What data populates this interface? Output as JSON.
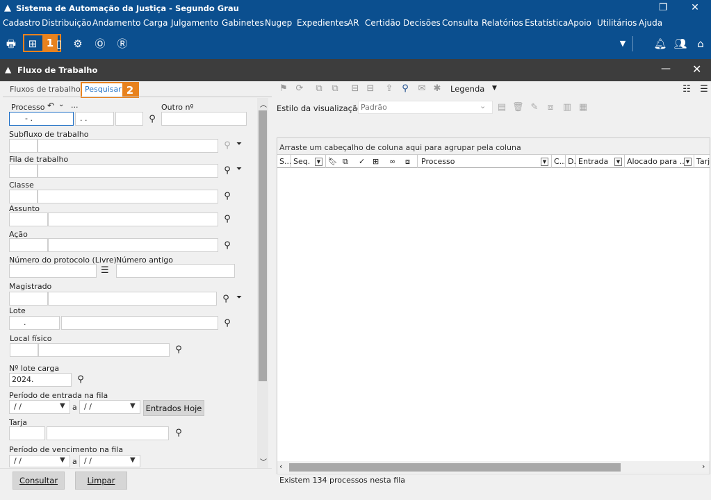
{
  "window": {
    "title": "Sistema de Automação da Justiça - Segundo Grau",
    "restore_icon": "restore-icon",
    "close_icon": "close-icon"
  },
  "menu": [
    "Cadastro",
    "Distribuição",
    "Andamento",
    "Carga",
    "Julgamento",
    "Gabinetes",
    "Nugep",
    "Expedientes",
    "AR",
    "Certidão",
    "Decisões",
    "Consulta",
    "Relatórios",
    "Estatística",
    "Apoio",
    "Utilitários",
    "Ajuda"
  ],
  "toolbar": {
    "badge1": "1",
    "badge2": "2"
  },
  "panel": {
    "title": "Fluxo de Trabalho"
  },
  "tabs": {
    "fluxos": "Fluxos de trabalho",
    "pesquisar": "Pesquisar"
  },
  "form": {
    "processo_label": "Processo",
    "processo_dots": "...",
    "processo_value": "-  .",
    "processo_part2": ".  .",
    "outro_label": "Outro nº",
    "subfluxo_label": "Subfluxo de trabalho",
    "fila_label": "Fila de trabalho",
    "classe_label": "Classe",
    "assunto_label": "Assunto",
    "acao_label": "Ação",
    "protocolo_label": "Número do protocolo (Livre)",
    "antigo_label": "Número antigo",
    "magistrado_label": "Magistrado",
    "lote_label": "Lote",
    "lote_value": ".",
    "local_label": "Local físico",
    "lote_carga_label": "Nº lote carga",
    "lote_carga_value": "2024.",
    "periodo_entrada_label": "Período de entrada na fila",
    "date_placeholder": "/ /",
    "date_sep": "a",
    "entrados_hoje": "Entrados Hoje",
    "tarja_label": "Tarja",
    "periodo_venc_label": "Período de vencimento na fila",
    "consultar": "Consultar",
    "limpar": "Limpar"
  },
  "right": {
    "legenda": "Legenda",
    "estilo_label": "Estilo da visualização",
    "estilo_value": "Padrão",
    "group_hint": "Arraste um cabeçalho de coluna aqui para agrupar pela coluna",
    "columns": {
      "s": "S...",
      "seq": "Seq.",
      "processo": "Processo",
      "c": "C...",
      "d": "D...",
      "entrada": "Entrada",
      "alocado": "Alocado para ...",
      "tarja": "Tarj"
    },
    "status": "Existem 134 processos nesta fila"
  },
  "colors": {
    "brand": "#0b4f8f",
    "highlight": "#e8821e",
    "panel_header": "#3d3d3d"
  }
}
